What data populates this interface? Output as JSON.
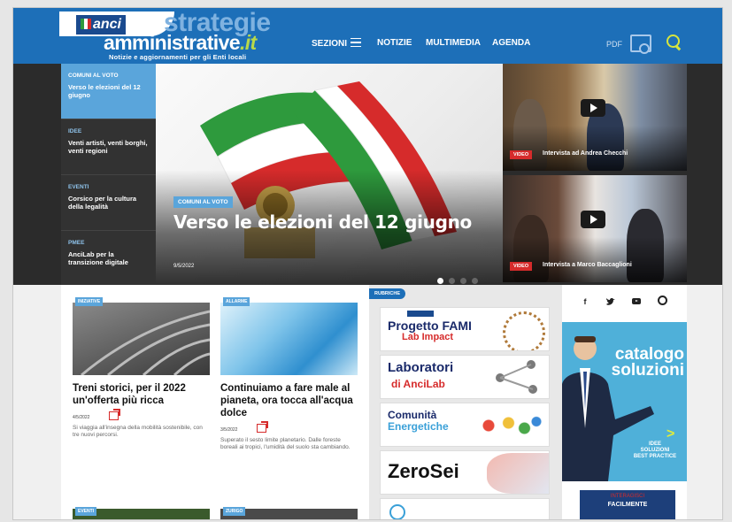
{
  "header": {
    "brand_small": "anci",
    "logo_line1": "strategie",
    "logo_line2": "amministrative",
    "logo_suffix": ".it",
    "tagline": "Notizie e aggiornamenti per gli Enti locali",
    "nav": [
      "SEZIONI",
      "NOTIZIE",
      "MULTIMEDIA",
      "AGENDA"
    ],
    "pdf_label": "PDF"
  },
  "side_menu": [
    {
      "category": "COMUNI AL VOTO",
      "title": "Verso le elezioni del 12 giugno"
    },
    {
      "category": "IDEE",
      "title": "Venti artisti, venti borghi, venti regioni"
    },
    {
      "category": "EVENTI",
      "title": "Corsico per la cultura della legalità"
    },
    {
      "category": "PMEE",
      "title": "AnciLab per la transizione digitale"
    }
  ],
  "hero": {
    "category": "COMUNI AL VOTO",
    "title": "Verso le elezioni del 12 giugno",
    "date": "9/5/2022",
    "slide_count": 4,
    "active_slide": 1
  },
  "videos": [
    {
      "tag": "VIDEO",
      "caption": "Intervista ad Andrea Checchi"
    },
    {
      "tag": "VIDEO",
      "caption": "Intervista a Marco Baccaglioni"
    }
  ],
  "articles": [
    {
      "category": "INIZIATIVE",
      "title": "Treni storici, per il 2022 un'offerta più ricca",
      "date": "4/5/2022",
      "summary": "Si viaggia all'insegna della mobilità sostenibile, con tre nuovi percorsi."
    },
    {
      "category": "ALLARME",
      "title": "Continuiamo a fare male al pianeta, ora tocca all'acqua dolce",
      "date": "3/5/2022",
      "summary": "Superato il sesto limite planetario. Dalle foreste boreali ai tropici, l'umidità del suolo sta cambiando."
    }
  ],
  "bottom_articles": [
    {
      "category": "EVENTI"
    },
    {
      "category": "ZURIGO"
    }
  ],
  "rubriche": {
    "label": "RUBRICHE",
    "items": [
      {
        "line1": "Progetto FAMI",
        "line2": "Lab Impact"
      },
      {
        "line1": "Laboratori",
        "line2": "di AnciLab"
      },
      {
        "line1": "Comunità",
        "line2": "Energetiche"
      },
      {
        "line1": "ZeroSei",
        "line2": ""
      }
    ]
  },
  "social": [
    "f",
    "t",
    "yt",
    "ig"
  ],
  "catalogo": {
    "title1": "catalogo",
    "title2": "soluzioni",
    "sub1": "IDEE",
    "sub2": "SOLUZIONI",
    "sub3": "BEST PRACTICE"
  },
  "interagisci": {
    "line1": "INTERAGISCI",
    "line2": "FACILMENTE"
  },
  "colors": {
    "brand_blue": "#1d6fb8",
    "accent_light_blue": "#5aa5db",
    "accent_green": "#b8d84a",
    "video_red": "#d62b2b"
  }
}
